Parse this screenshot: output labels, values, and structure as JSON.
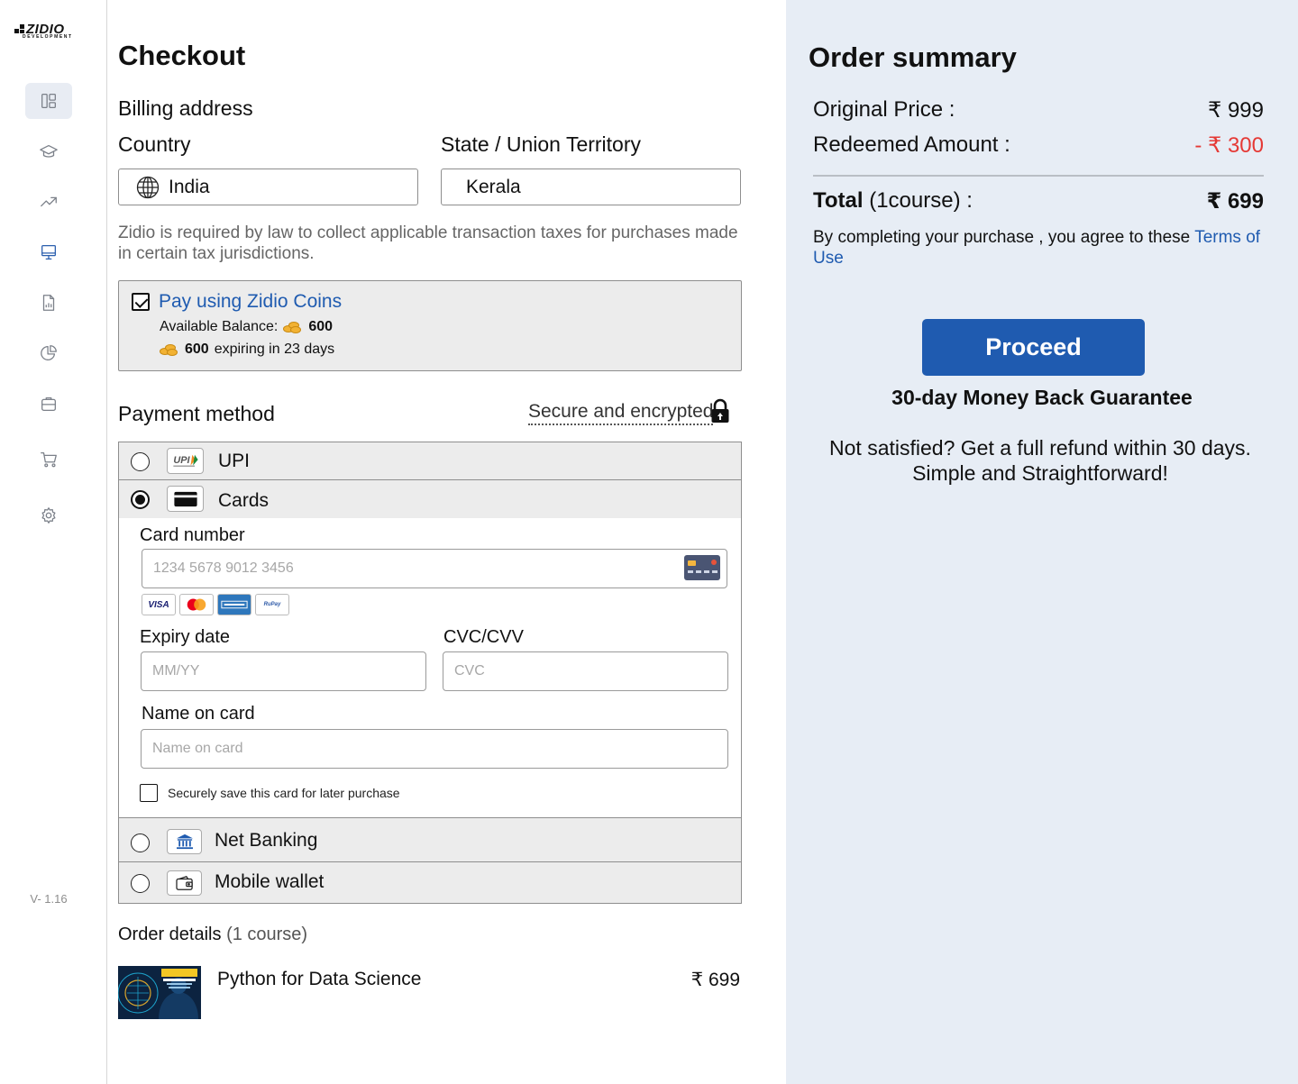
{
  "brand": {
    "name": "ZIDIO",
    "tagline": "DEVELOPMENT"
  },
  "sidebar": {
    "items": [
      {
        "id": "dashboard",
        "icon": "layout-dashboard-icon"
      },
      {
        "id": "courses",
        "icon": "graduation-cap-icon"
      },
      {
        "id": "progress",
        "icon": "trending-up-icon"
      },
      {
        "id": "classroom",
        "icon": "monitor-icon"
      },
      {
        "id": "reports",
        "icon": "file-chart-icon"
      },
      {
        "id": "analytics",
        "icon": "pie-chart-icon"
      },
      {
        "id": "jobs",
        "icon": "briefcase-icon"
      },
      {
        "id": "cart",
        "icon": "shopping-cart-icon"
      },
      {
        "id": "settings",
        "icon": "gear-icon"
      }
    ],
    "version": "V- 1.16"
  },
  "checkout": {
    "title": "Checkout",
    "billing_heading": "Billing address",
    "country_label": "Country",
    "country_value": "India",
    "state_label": "State / Union Territory",
    "state_value": "Kerala",
    "tax_notice": "Zidio is required by law to collect applicable transaction taxes for purchases made in certain tax jurisdictions.",
    "coins": {
      "checked": true,
      "label": "Pay using Zidio Coins",
      "available_label": "Available Balance:",
      "available_amount": "600",
      "expiring_amount": "600",
      "expiring_text": "expiring in 23 days"
    },
    "payment_heading": "Payment method",
    "secure_text": "Secure and encrypted",
    "methods": {
      "upi": {
        "label": "UPI",
        "selected": false
      },
      "cards": {
        "label": "Cards",
        "selected": true
      },
      "netbanking": {
        "label": "Net Banking",
        "selected": false
      },
      "wallet": {
        "label": "Mobile wallet",
        "selected": false
      }
    },
    "card_form": {
      "number_label": "Card number",
      "number_placeholder": "1234 5678 9012 3456",
      "brands": [
        "VISA",
        "Mastercard",
        "American Express",
        "RuPay"
      ],
      "expiry_label": "Expiry date",
      "expiry_placeholder": "MM/YY",
      "cvc_label": "CVC/CVV",
      "cvc_placeholder": "CVC",
      "name_label": "Name on card",
      "name_placeholder": "Name on card",
      "save_label": "Securely save this card for later purchase",
      "save_checked": false
    },
    "order_details": {
      "heading": "Order details",
      "count": "(1 course)",
      "items": [
        {
          "name": "Python for Data Science",
          "price": "₹ 699"
        }
      ]
    }
  },
  "summary": {
    "title": "Order summary",
    "original_label": "Original Price :",
    "original_value": "₹ 999",
    "redeemed_label": "Redeemed Amount :",
    "redeemed_value": "- ₹ 300",
    "total_label": "Total",
    "total_count": "(1course) :",
    "total_value": "₹ 699",
    "agree_text": "By completing your purchase , you agree to these",
    "terms_link": "Terms of Use",
    "proceed_label": "Proceed",
    "guarantee": "30-day Money Back Guarantee",
    "refund_line1": "Not satisfied? Get a full refund within 30 days.",
    "refund_line2": "Simple and Straightforward!"
  },
  "colors": {
    "accent": "#1f5bb0",
    "summary_bg": "#e7edf5",
    "discount": "#e53935"
  }
}
